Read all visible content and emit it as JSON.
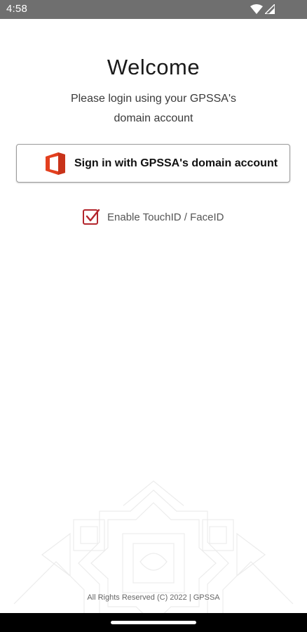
{
  "status_bar": {
    "time": "4:58",
    "icons": [
      "wifi-icon",
      "cellular-signal-icon"
    ]
  },
  "welcome": {
    "title": "Welcome",
    "subtitle_line1": "Please login using your GPSSA's",
    "subtitle_line2": "domain account"
  },
  "signin": {
    "icon": "office-icon",
    "label": "Sign in with GPSSA's domain account",
    "brand_color": "#e3401f"
  },
  "touchid": {
    "checked": true,
    "label": "Enable TouchID / FaceID",
    "accent_color": "#b3262d"
  },
  "footer": {
    "text": "All Rights Reserved (C) 2022  | GPSSA"
  }
}
